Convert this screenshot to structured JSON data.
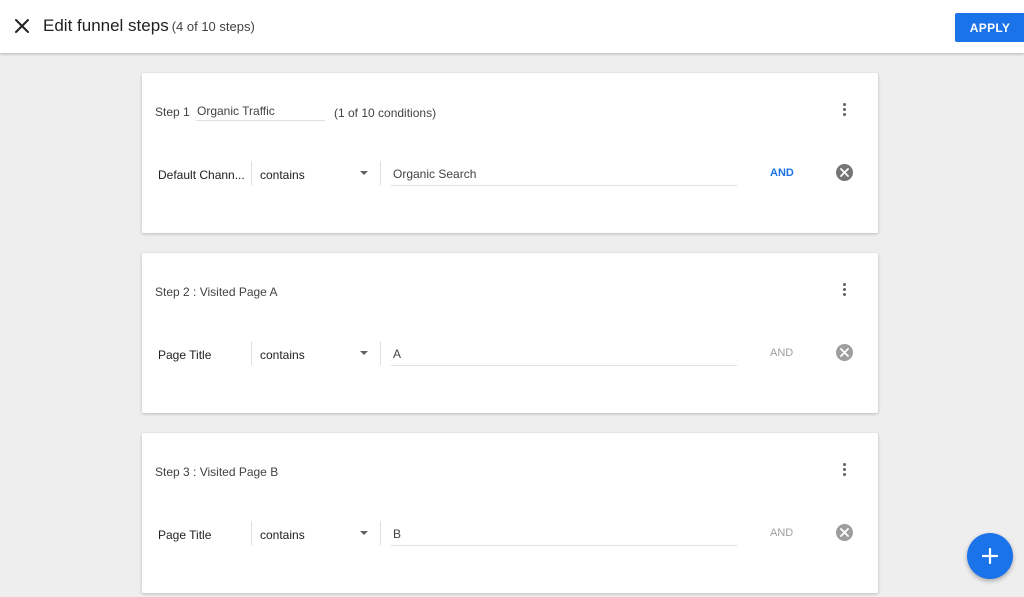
{
  "header": {
    "title": "Edit funnel steps",
    "subtitle": "(4 of 10 steps)",
    "apply_label": "APPLY"
  },
  "steps": [
    {
      "label": "Step 1",
      "name": "Organic Traffic",
      "condition_count": "(1 of 10 conditions)",
      "condition": {
        "dimension": "Default Chann...",
        "operator": "contains",
        "value": "Organic Search",
        "and_label": "AND"
      }
    },
    {
      "label": "Step 2 : Visited Page A",
      "condition": {
        "dimension": "Page Title",
        "operator": "contains",
        "value": "A",
        "and_label": "AND"
      }
    },
    {
      "label": "Step 3 : Visited Page B",
      "condition": {
        "dimension": "Page Title",
        "operator": "contains",
        "value": "B",
        "and_label": "AND"
      }
    }
  ],
  "colors": {
    "accent": "#1a73e8",
    "background": "#eeeeee"
  },
  "icons": {
    "close": "close-icon",
    "more": "more-vert-icon",
    "remove": "remove-circle-icon",
    "add": "add-icon"
  }
}
